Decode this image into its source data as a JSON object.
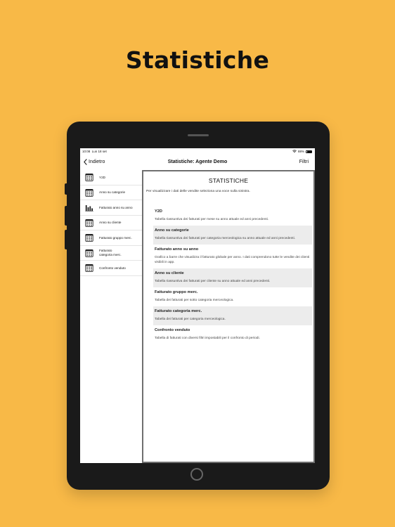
{
  "headline": "Statistiche",
  "status_bar": {
    "time": "10:08",
    "date": "Lun 18 set",
    "battery": "88%"
  },
  "nav": {
    "back_label": "Indietro",
    "title": "Statistiche: Agente Demo",
    "filter_label": "Filtri"
  },
  "sidebar": {
    "items": [
      {
        "label": "Y2D",
        "icon": "calendar-icon"
      },
      {
        "label": "Anno su categorie",
        "icon": "calendar-icon"
      },
      {
        "label": "Fatturato anno su anno",
        "icon": "bar-chart-icon"
      },
      {
        "label": "Anno su cliente",
        "icon": "calendar-icon"
      },
      {
        "label": "Fatturato gruppo merc.",
        "icon": "calendar-icon"
      },
      {
        "label": "Fatturato categoria merc.",
        "icon": "calendar-icon"
      },
      {
        "label": "Confronto venduto",
        "icon": "calendar-icon"
      }
    ]
  },
  "panel": {
    "title": "STATISTICHE",
    "subtitle": "Per visualizzare i dati delle vendite seleziona una voce sulla sinistra.",
    "entries": [
      {
        "title": "Y2D",
        "desc": "Tabella riassuntiva dei fatturati per mese su anno attuale ed anni precedenti."
      },
      {
        "title": "Anno su categorie",
        "desc": "Tabella riassuntiva dei fatturati per categoria merceologica su anno attuale ed anni precedenti."
      },
      {
        "title": "Fatturato anno su anno",
        "desc": "Grafico a barre che visualizza il fatturato globale per anno. I dati comprendono tutte le vendite dei clienti visibili in app."
      },
      {
        "title": "Anno su cliente",
        "desc": "Tabella riassuntiva dei fatturati per cliente su anno attuale ed anni precedenti."
      },
      {
        "title": "Fatturato gruppo merc.",
        "desc": "Tabella dei fatturati per sotto categoria merceologica."
      },
      {
        "title": "Fatturato categoria merc.",
        "desc": "Tabella dei fatturati per categoria merceologica."
      },
      {
        "title": "Confronto venduto",
        "desc": "Tabella di fatturati con diversi filtri impostabili per il confronto di periodi."
      }
    ]
  }
}
